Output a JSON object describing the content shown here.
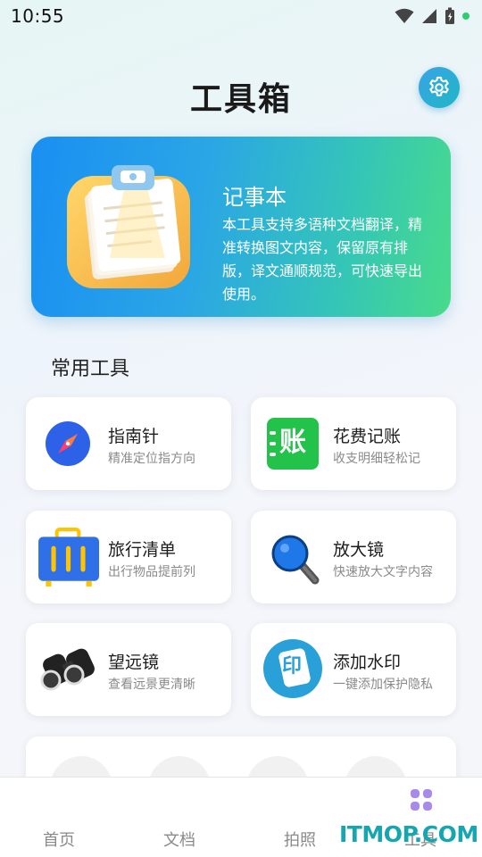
{
  "status_bar": {
    "time": "10:55"
  },
  "header": {
    "title": "工具箱"
  },
  "hero": {
    "title": "记事本",
    "description": "本工具支持多语种文档翻译，精准转换图文内容，保留原有排版，译文通顺规范，可快速导出使用。"
  },
  "section": {
    "title": "常用工具"
  },
  "tools": [
    {
      "name": "指南针",
      "desc": "精准定位指方向",
      "icon": "compass-icon"
    },
    {
      "name": "花费记账",
      "desc": "收支明细轻松记",
      "icon": "ledger-icon"
    },
    {
      "name": "旅行清单",
      "desc": "出行物品提前列",
      "icon": "suitcase-icon"
    },
    {
      "name": "放大镜",
      "desc": "快速放大文字内容",
      "icon": "magnifier-icon"
    },
    {
      "name": "望远镜",
      "desc": "查看远景更清晰",
      "icon": "binoculars-icon"
    },
    {
      "name": "添加水印",
      "desc": "一键添加保护隐私",
      "icon": "watermark-icon"
    }
  ],
  "ledger_icon_char": "账",
  "watermark_icon_char": "印",
  "bottom_nav": {
    "items": [
      "首页",
      "文档",
      "拍照",
      "工具"
    ],
    "active_index": 3
  },
  "watermark": "ITMOP.COM",
  "colors": {
    "accent": "#1fb7c4",
    "hero_start": "#1a8ff2",
    "hero_end": "#48db8a",
    "active_nav": "#a78be8"
  }
}
